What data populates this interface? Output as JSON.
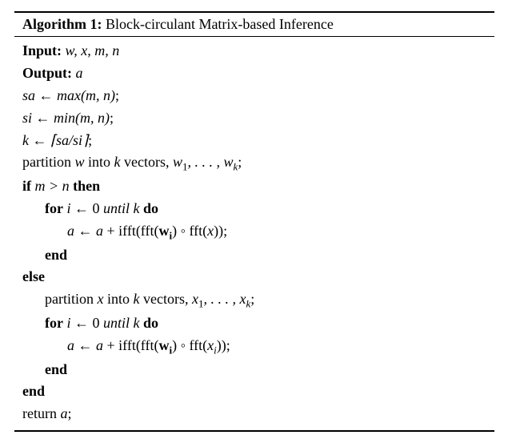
{
  "algo": {
    "label": "Algorithm 1:",
    "title": "Block-circulant Matrix-based Inference",
    "input_kw": "Input:",
    "input_vars": "w, x, m, n",
    "output_kw": "Output:",
    "output_vars": "a",
    "assign_sa_lhs": "sa",
    "assign_sa_rhs": "max(m, n)",
    "assign_si_lhs": "si",
    "assign_si_rhs": "min(m, n)",
    "assign_k_lhs": "k",
    "assign_k_rhs": "⌈sa/si⌉",
    "partition_w_a": "partition ",
    "partition_w_b": "w",
    "partition_w_c": " into ",
    "partition_w_d": "k",
    "partition_w_e": " vectors, ",
    "partition_w_f": "w",
    "partition_w_g": ", . . . , ",
    "partition_w_h": "w",
    "kw_if": "if",
    "if_cond": "m > n",
    "kw_then": "then",
    "kw_for": "for",
    "for_iter_lhs": "i",
    "for_iter_start": "0",
    "kw_until": "until",
    "for_iter_end": "k",
    "kw_do": "do",
    "update1_a_lhs": "a",
    "update1_a_rhs_p1": "a",
    "update1_a_rhs_p2": " + ifft(fft(",
    "update1_w": "w",
    "update1_rhs_p3": ") ◦ fft(",
    "update1_x": "x",
    "update1_rhs_p4": "));",
    "kw_end": "end",
    "kw_else": "else",
    "partition_x_a": "partition ",
    "partition_x_b": "x",
    "partition_x_c": " into ",
    "partition_x_d": "k",
    "partition_x_e": " vectors, ",
    "partition_x_f": "x",
    "partition_x_g": ", . . . , ",
    "partition_x_h": "x",
    "update2_a_lhs": "a",
    "update2_a_rhs_p1": "a",
    "update2_a_rhs_p2": " + ifft(fft(",
    "update2_w": "w",
    "update2_rhs_p3": ") ◦ fft(",
    "update2_x": "x",
    "update2_rhs_p4": "));",
    "return_kw": "return ",
    "return_var": "a",
    "arrow": " ← ",
    "semi": ";",
    "sub_1": "1",
    "sub_k": "k",
    "sub_i": "i",
    "sub_ib": "i"
  }
}
